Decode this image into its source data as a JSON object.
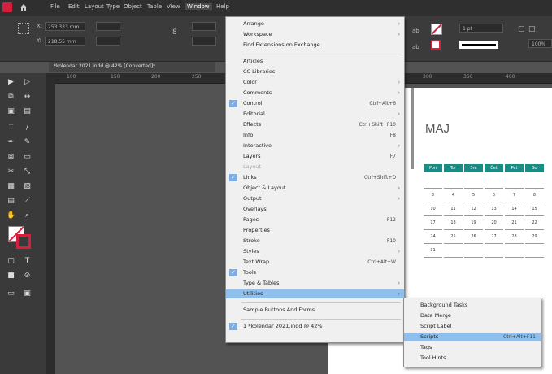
{
  "menubar": {
    "items": [
      "File",
      "Edit",
      "Layout",
      "Type",
      "Object",
      "Table",
      "View",
      "Window",
      "Help"
    ],
    "active": "Window"
  },
  "control": {
    "x_value": "253.333 mm",
    "y_value": "218.55 mm",
    "stroke_weight": "1 pt",
    "zoom": "100%"
  },
  "document_tab": "*kolendar 2021.indd @ 42% [Converted]*",
  "ruler_ticks": [
    "100",
    "150",
    "200",
    "250",
    "300",
    "350",
    "400"
  ],
  "window_menu": [
    {
      "label": "Arrange",
      "arrow": true
    },
    {
      "label": "Workspace",
      "arrow": true
    },
    {
      "label": "Find Extensions on Exchange..."
    },
    {
      "sep": true
    },
    {
      "label": "Articles"
    },
    {
      "label": "CC Libraries"
    },
    {
      "label": "Color",
      "arrow": true
    },
    {
      "label": "Comments",
      "arrow": true
    },
    {
      "label": "Control",
      "shortcut": "Ctrl+Alt+6",
      "checked": true
    },
    {
      "label": "Editorial",
      "arrow": true
    },
    {
      "label": "Effects",
      "shortcut": "Ctrl+Shift+F10"
    },
    {
      "label": "Info",
      "shortcut": "F8"
    },
    {
      "label": "Interactive",
      "arrow": true
    },
    {
      "label": "Layers",
      "shortcut": "F7"
    },
    {
      "label": "Layout",
      "disabled": true
    },
    {
      "label": "Links",
      "shortcut": "Ctrl+Shift+D",
      "checked": true
    },
    {
      "label": "Object & Layout",
      "arrow": true
    },
    {
      "label": "Output",
      "arrow": true
    },
    {
      "label": "Overlays"
    },
    {
      "label": "Pages",
      "shortcut": "F12"
    },
    {
      "label": "Properties"
    },
    {
      "label": "Stroke",
      "shortcut": "F10"
    },
    {
      "label": "Styles",
      "arrow": true
    },
    {
      "label": "Text Wrap",
      "shortcut": "Ctrl+Alt+W"
    },
    {
      "label": "Tools",
      "checked": true
    },
    {
      "label": "Type & Tables",
      "arrow": true
    },
    {
      "label": "Utilities",
      "arrow": true,
      "highlighted": true
    },
    {
      "sep": true
    },
    {
      "label": "Sample Buttons And Forms"
    },
    {
      "sep": true
    },
    {
      "label": "1 *kolendar 2021.indd @ 42%",
      "checked": true
    }
  ],
  "utilities_submenu": [
    {
      "label": "Background Tasks"
    },
    {
      "label": "Data Merge"
    },
    {
      "label": "Script Label"
    },
    {
      "label": "Scripts",
      "shortcut": "Ctrl+Alt+F11",
      "highlighted": true
    },
    {
      "label": "Tags"
    },
    {
      "label": "Tool Hints"
    }
  ],
  "calendar": {
    "month": "MAJ",
    "days": [
      "Pon",
      "Tor",
      "Sre",
      "Čet",
      "Pet",
      "So"
    ],
    "rows": [
      [
        "",
        "",
        "",
        "",
        "",
        ""
      ],
      [
        "3",
        "4",
        "5",
        "6",
        "7",
        "8"
      ],
      [
        "10",
        "11",
        "12",
        "13",
        "14",
        "15"
      ],
      [
        "17",
        "18",
        "19",
        "20",
        "21",
        "22"
      ],
      [
        "24",
        "25",
        "26",
        "27",
        "28",
        "29"
      ],
      [
        "31",
        "",
        "",
        "",
        "",
        ""
      ]
    ]
  },
  "colors": {
    "accent": "#1b8c84",
    "menu_highlight": "#8fbfec",
    "app_red": "#d71f3c"
  }
}
